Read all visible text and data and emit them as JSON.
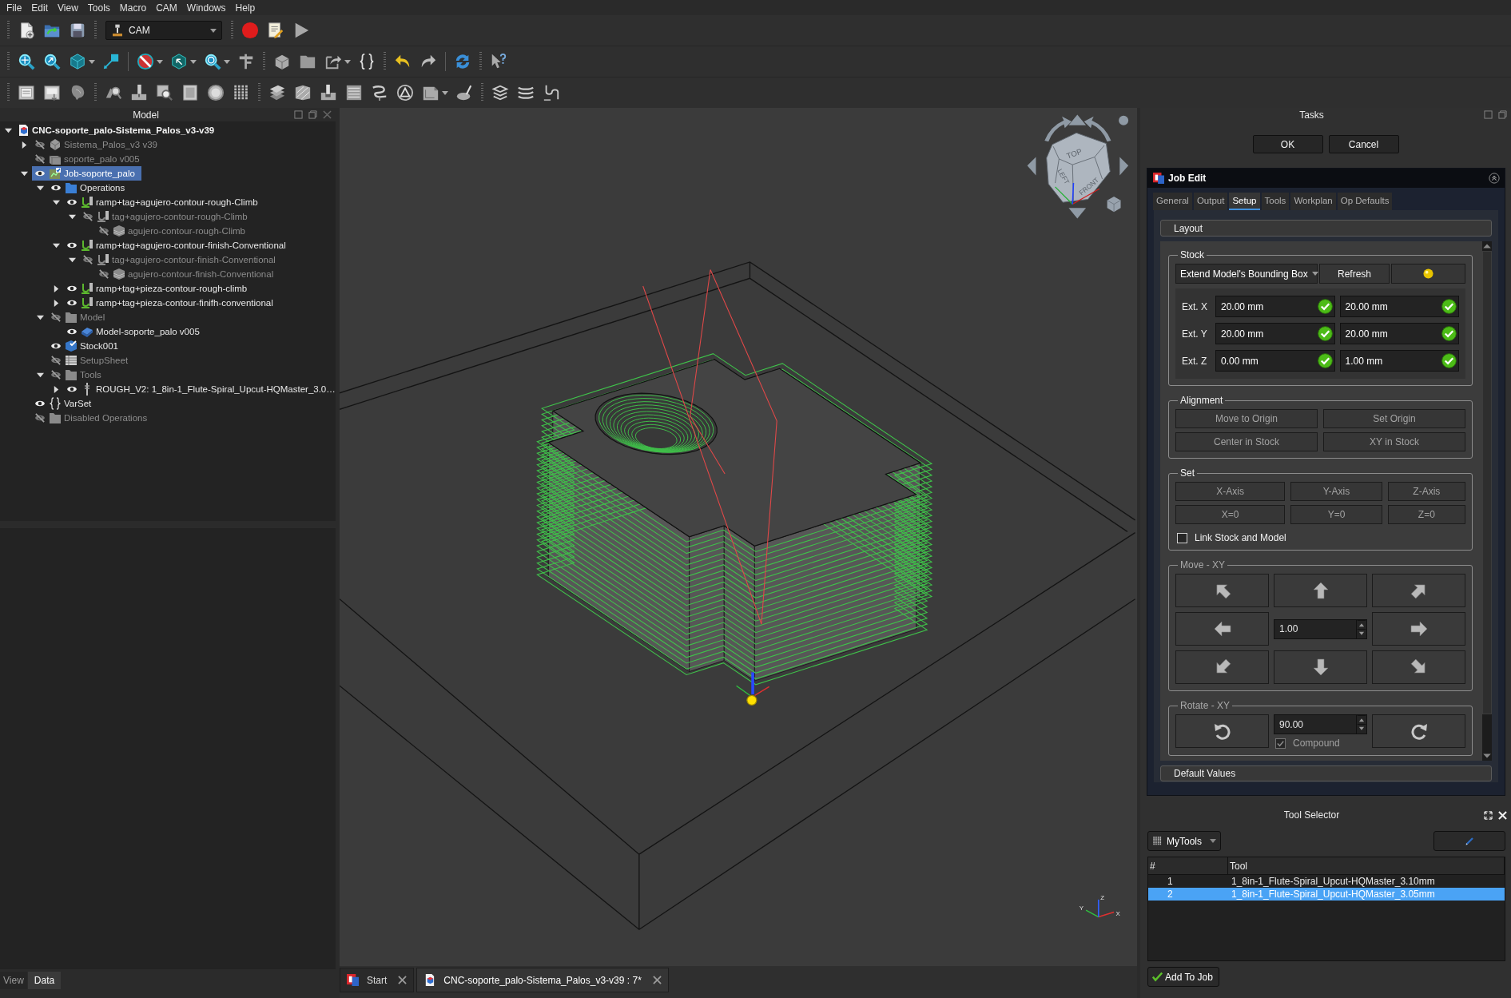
{
  "menu": [
    "File",
    "Edit",
    "View",
    "Tools",
    "Macro",
    "CAM",
    "Windows",
    "Help"
  ],
  "toolbar": {
    "workbench": "CAM"
  },
  "model_panel": {
    "title": "Model",
    "tree": [
      {
        "label": "CNC-soporte_palo-Sistema_Palos_v3-v39",
        "kind": "document",
        "expanded": true,
        "selected": false,
        "children": [
          {
            "label": "Sistema_Palos_v3 v39",
            "kind": "body",
            "visible": false,
            "expanded": false,
            "selected": false
          },
          {
            "label": "soporte_palo v005",
            "kind": "box",
            "visible": false,
            "selected": false
          },
          {
            "label": "Job-soporte_palo",
            "kind": "job",
            "visible": true,
            "expanded": true,
            "selected": true,
            "children": [
              {
                "label": "Operations",
                "kind": "folder",
                "visible": true,
                "expanded": true,
                "selected": false,
                "children": [
                  {
                    "label": "ramp+tag+agujero-contour-rough-Climb",
                    "kind": "operation",
                    "visible": true,
                    "expanded": true,
                    "selected": false,
                    "children": [
                      {
                        "label": "tag+agujero-contour-rough-Climb",
                        "kind": "operation",
                        "visible": false,
                        "expanded": true,
                        "selected": false,
                        "children": [
                          {
                            "label": "agujero-contour-rough-Climb",
                            "kind": "profile",
                            "visible": false,
                            "selected": false
                          }
                        ]
                      }
                    ]
                  },
                  {
                    "label": "ramp+tag+agujero-contour-finish-Conventional",
                    "kind": "operation",
                    "visible": true,
                    "expanded": true,
                    "selected": false,
                    "children": [
                      {
                        "label": "tag+agujero-contour-finish-Conventional",
                        "kind": "operation",
                        "visible": false,
                        "expanded": true,
                        "selected": false,
                        "children": [
                          {
                            "label": "agujero-contour-finish-Conventional",
                            "kind": "profile",
                            "visible": false,
                            "selected": false
                          }
                        ]
                      }
                    ]
                  },
                  {
                    "label": "ramp+tag+pieza-contour-rough-climb",
                    "kind": "operation",
                    "visible": true,
                    "expanded": false,
                    "selected": false
                  },
                  {
                    "label": "ramp+tag+pieza-contour-finifh-conventional",
                    "kind": "operation",
                    "visible": true,
                    "expanded": false,
                    "selected": false
                  }
                ]
              },
              {
                "label": "Model",
                "kind": "folder",
                "visible": false,
                "expanded": true,
                "selected": false,
                "children": [
                  {
                    "label": "Model-soporte_palo v005",
                    "kind": "clone",
                    "visible": true,
                    "selected": false
                  }
                ]
              },
              {
                "label": "Stock001",
                "kind": "stock",
                "visible": true,
                "selected": false
              },
              {
                "label": "SetupSheet",
                "kind": "sheet",
                "visible": false,
                "selected": false
              },
              {
                "label": "Tools",
                "kind": "folder",
                "visible": false,
                "expanded": true,
                "selected": false,
                "children": [
                  {
                    "label": "ROUGH_V2: 1_8in-1_Flute-Spiral_Upcut-HQMaster_3.0…",
                    "kind": "toolbit",
                    "visible": true,
                    "expanded": false,
                    "selected": false
                  }
                ]
              }
            ]
          },
          {
            "label": "VarSet",
            "kind": "varset",
            "visible": true,
            "selected": false
          },
          {
            "label": "Disabled Operations",
            "kind": "folder",
            "visible": false,
            "selected": false
          }
        ]
      }
    ]
  },
  "property_tabs": [
    {
      "label": "View",
      "selected": false
    },
    {
      "label": "Data",
      "selected": true
    }
  ],
  "viewport": {
    "cube_labels": [
      "TOP",
      "LEFT",
      "FRONT"
    ],
    "axis_labels": [
      "X",
      "Y",
      "Z"
    ]
  },
  "document_tabs": [
    {
      "label": "Start",
      "kind": "start",
      "selected": false
    },
    {
      "label": "CNC-soporte_palo-Sistema_Palos_v3-v39 : 7*",
      "kind": "document",
      "selected": true
    }
  ],
  "tasks": {
    "title": "Tasks",
    "buttons": [
      "OK",
      "Cancel"
    ],
    "job_edit": {
      "title": "Job Edit",
      "tabs": [
        {
          "label": "General",
          "selected": false
        },
        {
          "label": "Output",
          "selected": false
        },
        {
          "label": "Setup",
          "selected": true
        },
        {
          "label": "Tools",
          "selected": false
        },
        {
          "label": "Workplan",
          "selected": false
        },
        {
          "label": "Op Defaults",
          "selected": false
        }
      ],
      "layout_bar": "Layout",
      "stock": {
        "title": "Stock",
        "mode": "Extend Model's Bounding Box",
        "refresh": "Refresh",
        "extents": [
          {
            "label": "Ext. X",
            "values": [
              "20.00 mm",
              "20.00 mm"
            ]
          },
          {
            "label": "Ext. Y",
            "values": [
              "20.00 mm",
              "20.00 mm"
            ]
          },
          {
            "label": "Ext. Z",
            "values": [
              "0.00 mm",
              "1.00 mm"
            ]
          }
        ]
      },
      "alignment": {
        "title": "Alignment",
        "buttons": [
          {
            "label": "Move to Origin",
            "disabled": true
          },
          {
            "label": "Set Origin",
            "disabled": true
          },
          {
            "label": "Center in Stock",
            "disabled": true
          },
          {
            "label": "XY in Stock",
            "disabled": true
          }
        ]
      },
      "set": {
        "title": "Set",
        "buttons": [
          {
            "label": "X-Axis",
            "disabled": true
          },
          {
            "label": "Y-Axis",
            "disabled": true
          },
          {
            "label": "Z-Axis",
            "disabled": true
          },
          {
            "label": "X=0",
            "disabled": true
          },
          {
            "label": "Y=0",
            "disabled": true
          },
          {
            "label": "Z=0",
            "disabled": true
          }
        ],
        "link_checkbox": {
          "label": "Link Stock and Model",
          "checked": false
        }
      },
      "move_xy": {
        "title": "Move - XY",
        "disabled": true,
        "step": "1.00"
      },
      "rotate_xy": {
        "title": "Rotate - XY",
        "disabled": true,
        "angle": "90.00",
        "compound": {
          "label": "Compound",
          "checked": true
        }
      },
      "default_values_bar": "Default Values"
    }
  },
  "tool_selector": {
    "title": "Tool Selector",
    "library": "MyTools",
    "columns": [
      "#",
      "Tool"
    ],
    "rows": [
      {
        "number": "1",
        "tool": "1_8in-1_Flute-Spiral_Upcut-HQMaster_3.10mm",
        "selected": false
      },
      {
        "number": "2",
        "tool": "1_8in-1_Flute-Spiral_Upcut-HQMaster_3.05mm",
        "selected": true
      }
    ],
    "add_button": "Add To Job"
  }
}
